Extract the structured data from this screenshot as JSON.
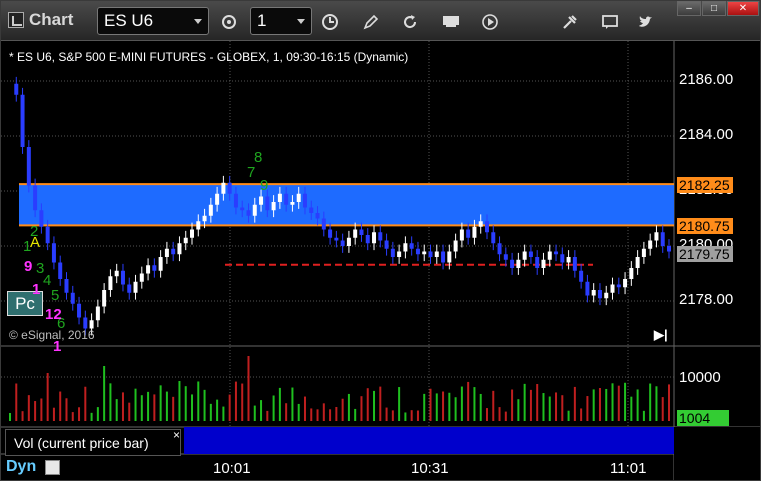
{
  "app": {
    "title": "Chart"
  },
  "toolbar": {
    "symbol_value": "ES U6",
    "interval_value": "1",
    "buttons": [
      {
        "name": "symbol-link-icon"
      },
      {
        "name": "clock-icon"
      },
      {
        "name": "pencil-icon"
      },
      {
        "name": "refresh-icon"
      },
      {
        "name": "get-data-icon"
      },
      {
        "name": "play-icon"
      },
      {
        "name": "tools-icon"
      },
      {
        "name": "comment-icon"
      },
      {
        "name": "twitter-icon"
      }
    ]
  },
  "window_controls": {
    "minimize": "–",
    "maximize": "□",
    "close": "✕"
  },
  "chart": {
    "header": "* ES U6, S&P 500 E-MINI FUTURES - GLOBEX, 1, 09:30-16:15 (Dynamic)",
    "copyright": "© eSignal, 2016",
    "pc_button": "Pc",
    "price_tags": {
      "upper": "2182.25",
      "lower": "2180.75",
      "last": "2179.75",
      "volume_last": "1004"
    },
    "price_labels": [
      "2186.00",
      "2184.00",
      "2182.00",
      "2180.00",
      "2178.00"
    ],
    "volume_labels": [
      "10000"
    ],
    "time_labels": [
      "10:01",
      "10:31",
      "11:01"
    ],
    "volume_panel_label": "Vol (current price bar)",
    "volume_panel_close": "×",
    "dyn_label": "Dyn",
    "marker_a": "A",
    "colors": {
      "zone_fill": "#1e6bff",
      "zone_line": "#ff8c1a",
      "dashed_level": "#e02020",
      "up_bar": "#ffffff",
      "down_bar": "#2a3dff",
      "setup_green": "#1fa51f",
      "setup_magenta": "#ff33ff",
      "vol_green": "#1fc01f",
      "vol_red": "#c01f1f"
    }
  },
  "chart_data": {
    "type": "candlestick",
    "symbol": "ES U6",
    "interval_minutes": 1,
    "y_axis_ticks": [
      2178.0,
      2180.0,
      2182.0,
      2184.0,
      2186.0
    ],
    "x_axis_ticks": [
      "10:01",
      "10:31",
      "11:01"
    ],
    "zone": {
      "low": 2180.75,
      "high": 2182.25
    },
    "dashed_level": 2179.5,
    "last_price": 2179.75,
    "volume_last": 1004,
    "volume_axis_ticks": [
      10000
    ],
    "setup_labels": [
      {
        "text": "1",
        "color": "green"
      },
      {
        "text": "2",
        "color": "green"
      },
      {
        "text": "3",
        "color": "green"
      },
      {
        "text": "4",
        "color": "green"
      },
      {
        "text": "5",
        "color": "green"
      },
      {
        "text": "6",
        "color": "green"
      },
      {
        "text": "7",
        "color": "green"
      },
      {
        "text": "8",
        "color": "green"
      },
      {
        "text": "9",
        "color": "green"
      },
      {
        "text": "9",
        "color": "magenta"
      },
      {
        "text": "1",
        "color": "magenta"
      },
      {
        "text": "1",
        "color": "magenta"
      },
      {
        "text": "12",
        "color": "magenta"
      }
    ]
  }
}
